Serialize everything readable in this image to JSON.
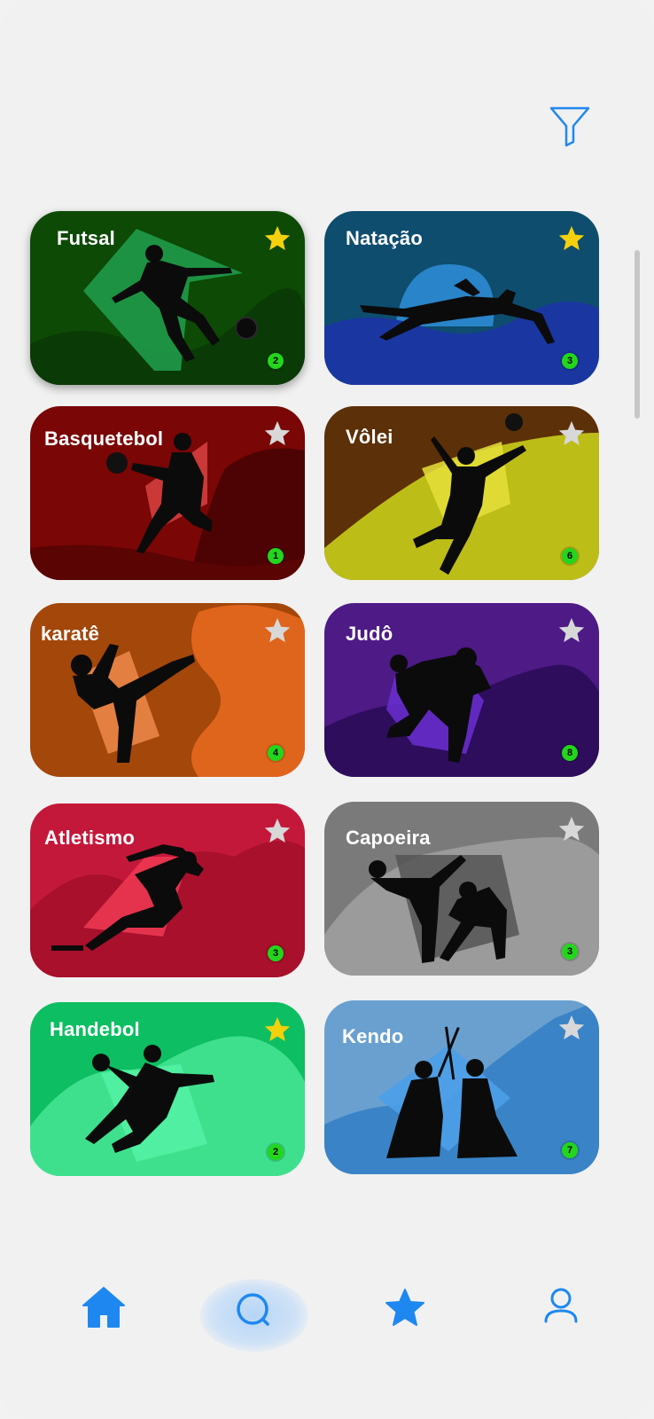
{
  "header": {
    "filter_icon": "filter-funnel-icon",
    "accent_color": "#1e88f0"
  },
  "sports": [
    {
      "name": "Futsal",
      "count": "2",
      "favorite": true
    },
    {
      "name": "Natação",
      "count": "3",
      "favorite": true
    },
    {
      "name": "Basquetebol",
      "count": "1",
      "favorite": false
    },
    {
      "name": "Vôlei",
      "count": "6",
      "favorite": false
    },
    {
      "name": "karatê",
      "count": "4",
      "favorite": false
    },
    {
      "name": "Judô",
      "count": "8",
      "favorite": false
    },
    {
      "name": "Atletismo",
      "count": "3",
      "favorite": false
    },
    {
      "name": "Capoeira",
      "count": "3",
      "favorite": false
    },
    {
      "name": "Handebol",
      "count": "2",
      "favorite": true
    },
    {
      "name": "Kendo",
      "count": "7",
      "favorite": false
    }
  ],
  "colors": {
    "favorite_star": "#f5d10c",
    "default_star": "#d8d8d8",
    "count_badge": "#22d61c"
  },
  "bottom_nav": {
    "items": [
      "home-icon",
      "search-icon",
      "star-icon",
      "user-icon"
    ],
    "active": "search-icon"
  }
}
